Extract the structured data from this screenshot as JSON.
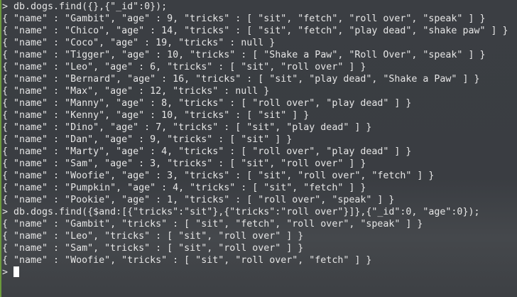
{
  "terminal": {
    "prompt": ">",
    "lines": [
      "> db.dogs.find({},{\"_id\":0});",
      "{ \"name\" : \"Gambit\", \"age\" : 9, \"tricks\" : [ \"sit\", \"fetch\", \"roll over\", \"speak\" ] }",
      "{ \"name\" : \"Chico\", \"age\" : 14, \"tricks\" : [ \"sit\", \"fetch\", \"play dead\", \"shake paw\" ] }",
      "{ \"name\" : \"Coco\", \"age\" : 19, \"tricks\" : null }",
      "{ \"name\" : \"Tigger\", \"age\" : 10, \"tricks\" : [ \"Shake a Paw\", \"Roll Over\", \"speak\" ] }",
      "{ \"name\" : \"Leo\", \"age\" : 6, \"tricks\" : [ \"sit\", \"roll over\" ] }",
      "{ \"name\" : \"Bernard\", \"age\" : 16, \"tricks\" : [ \"sit\", \"play dead\", \"Shake a Paw\" ] }",
      "{ \"name\" : \"Max\", \"age\" : 12, \"tricks\" : null }",
      "{ \"name\" : \"Manny\", \"age\" : 8, \"tricks\" : [ \"roll over\", \"play dead\" ] }",
      "{ \"name\" : \"Kenny\", \"age\" : 10, \"tricks\" : [ \"sit\" ] }",
      "{ \"name\" : \"Dino\", \"age\" : 7, \"tricks\" : [ \"sit\", \"play dead\" ] }",
      "{ \"name\" : \"Dan\", \"age\" : 9, \"tricks\" : [ \"sit\" ] }",
      "{ \"name\" : \"Marty\", \"age\" : 4, \"tricks\" : [ \"roll over\", \"play dead\" ] }",
      "{ \"name\" : \"Sam\", \"age\" : 3, \"tricks\" : [ \"sit\", \"roll over\" ] }",
      "{ \"name\" : \"Woofie\", \"age\" : 3, \"tricks\" : [ \"sit\", \"roll over\", \"fetch\" ] }",
      "{ \"name\" : \"Pumpkin\", \"age\" : 4, \"tricks\" : [ \"sit\", \"fetch\" ] }",
      "{ \"name\" : \"Pookie\", \"age\" : 1, \"tricks\" : [ \"roll over\", \"speak\" ] }",
      "> db.dogs.find({$and:[{\"tricks\":\"sit\"},{\"tricks\":\"roll over\"}]},{\"_id\":0, \"age\":0});",
      "{ \"name\" : \"Gambit\", \"tricks\" : [ \"sit\", \"fetch\", \"roll over\", \"speak\" ] }",
      "{ \"name\" : \"Leo\", \"tricks\" : [ \"sit\", \"roll over\" ] }",
      "{ \"name\" : \"Sam\", \"tricks\" : [ \"sit\", \"roll over\" ] }",
      "{ \"name\" : \"Woofie\", \"tricks\" : [ \"sit\", \"roll over\", \"fetch\" ] }"
    ]
  }
}
